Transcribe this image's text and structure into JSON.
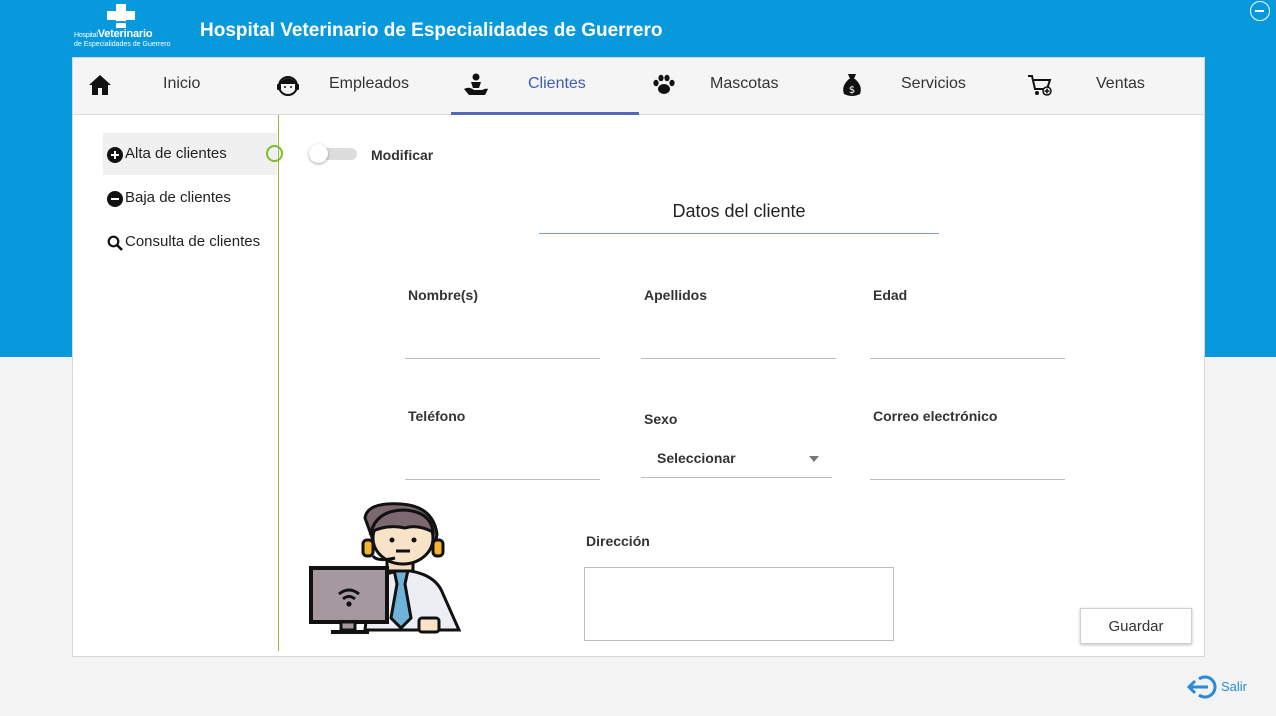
{
  "app": {
    "title": "Hospital Veterinario de Especialidades de Guerrero",
    "logo_line1_small": "Hospital",
    "logo_line1_big": "Veterinario",
    "logo_line2": "de Especialidades de Guerrero"
  },
  "nav": {
    "tabs": [
      {
        "label": "Inicio",
        "icon": "home-icon"
      },
      {
        "label": "Empleados",
        "icon": "employee-icon"
      },
      {
        "label": "Clientes",
        "icon": "clients-icon",
        "active": true
      },
      {
        "label": "Mascotas",
        "icon": "paw-icon"
      },
      {
        "label": "Servicios",
        "icon": "money-bag-icon"
      },
      {
        "label": "Ventas",
        "icon": "cart-icon"
      }
    ]
  },
  "sidebar": {
    "items": [
      {
        "label": "Alta de clientes",
        "icon": "plus-circle-icon",
        "active": true
      },
      {
        "label": "Baja de clientes",
        "icon": "minus-circle-icon"
      },
      {
        "label": "Consulta de clientes",
        "icon": "search-icon"
      }
    ]
  },
  "toggle": {
    "label": "Modificar",
    "on": false
  },
  "form": {
    "title": "Datos del cliente",
    "nombre_label": "Nombre(s)",
    "apellidos_label": "Apellidos",
    "edad_label": "Edad",
    "telefono_label": "Teléfono",
    "sexo_label": "Sexo",
    "sexo_value": "Seleccionar",
    "correo_label": "Correo electrónico",
    "direccion_label": "Dirección",
    "save_label": "Guardar"
  },
  "footer": {
    "exit_label": "Salir"
  },
  "colors": {
    "primary": "#0899dd",
    "active_tab": "#5566b8",
    "sidebar_accent": "#9cb83a"
  }
}
